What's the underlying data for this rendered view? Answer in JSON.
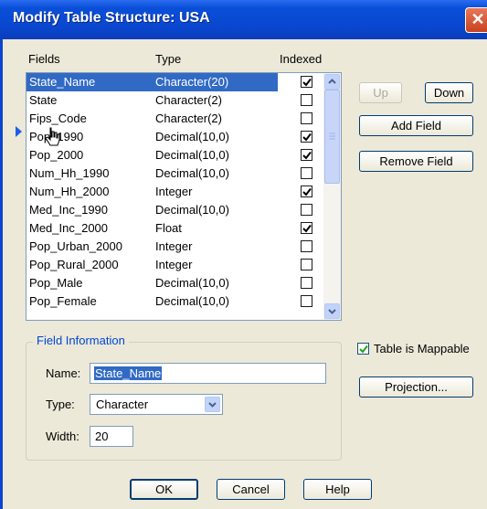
{
  "window": {
    "title": "Modify Table Structure: USA",
    "close_glyph": "✕"
  },
  "headers": {
    "fields": "Fields",
    "type": "Type",
    "indexed": "Indexed"
  },
  "fields": [
    {
      "name": "State_Name",
      "type": "Character(20)",
      "indexed": true,
      "selected": true
    },
    {
      "name": "State",
      "type": "Character(2)",
      "indexed": false
    },
    {
      "name": "Fips_Code",
      "type": "Character(2)",
      "indexed": false
    },
    {
      "name": "Pop_1990",
      "type": "Decimal(10,0)",
      "indexed": true
    },
    {
      "name": "Pop_2000",
      "type": "Decimal(10,0)",
      "indexed": true
    },
    {
      "name": "Num_Hh_1990",
      "type": "Decimal(10,0)",
      "indexed": false
    },
    {
      "name": "Num_Hh_2000",
      "type": "Integer",
      "indexed": true
    },
    {
      "name": "Med_Inc_1990",
      "type": "Decimal(10,0)",
      "indexed": false
    },
    {
      "name": "Med_Inc_2000",
      "type": "Float",
      "indexed": true
    },
    {
      "name": "Pop_Urban_2000",
      "type": "Integer",
      "indexed": false
    },
    {
      "name": "Pop_Rural_2000",
      "type": "Integer",
      "indexed": false
    },
    {
      "name": "Pop_Male",
      "type": "Decimal(10,0)",
      "indexed": false
    },
    {
      "name": "Pop_Female",
      "type": "Decimal(10,0)",
      "indexed": false
    }
  ],
  "buttons": {
    "up": "Up",
    "down": "Down",
    "add_field": "Add Field",
    "remove_field": "Remove Field",
    "projection": "Projection...",
    "ok": "OK",
    "cancel": "Cancel",
    "help": "Help"
  },
  "field_info": {
    "group_label": "Field Information",
    "name_label": "Name:",
    "name_value": "State_Name",
    "type_label": "Type:",
    "type_value": "Character",
    "width_label": "Width:",
    "width_value": "20"
  },
  "mappable": {
    "label": "Table is Mappable",
    "checked": true
  },
  "colors": {
    "title_bar": "#0a46cf",
    "selection": "#316ac5",
    "group_label": "#0046d5"
  },
  "icons": [
    "close-icon",
    "scroll-up-icon",
    "scroll-down-icon",
    "dropdown-arrow-icon",
    "current-row-arrow-icon",
    "mouse-cursor-icon",
    "checkmark-icon"
  ]
}
